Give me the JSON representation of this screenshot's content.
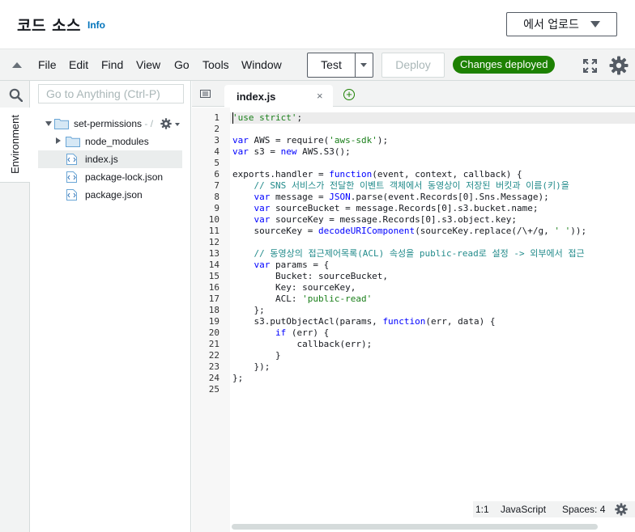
{
  "header": {
    "title": "코드 소스",
    "info_link": "Info",
    "upload_button": "에서 업로드"
  },
  "menubar": {
    "items": [
      "File",
      "Edit",
      "Find",
      "View",
      "Go",
      "Tools",
      "Window"
    ],
    "test_label": "Test",
    "deploy_label": "Deploy",
    "status_badge": "Changes deployed"
  },
  "sidebar": {
    "tab_label": "Environment",
    "search_placeholder": "Go to Anything (Ctrl-P)"
  },
  "tree": {
    "root": "set-permissions",
    "root_suffix": " - /",
    "items": [
      {
        "name": "node_modules",
        "type": "folder"
      },
      {
        "name": "index.js",
        "type": "file",
        "selected": true
      },
      {
        "name": "package-lock.json",
        "type": "file"
      },
      {
        "name": "package.json",
        "type": "file"
      }
    ]
  },
  "editor": {
    "tab_label": "index.js",
    "tab_close": "×",
    "add_tab": "+",
    "active_line": 1,
    "lines": [
      "'use strict';",
      "",
      "var AWS = require('aws-sdk');",
      "var s3 = new AWS.S3();",
      "",
      "exports.handler = function(event, context, callback) {",
      "    // SNS 서비스가 전달한 이벤트 객체에서 동영상이 저장된 버킷과 이름(키)을",
      "    var message = JSON.parse(event.Records[0].Sns.Message);",
      "    var sourceBucket = message.Records[0].s3.bucket.name;",
      "    var sourceKey = message.Records[0].s3.object.key;",
      "    sourceKey = decodeURIComponent(sourceKey.replace(/\\+/g, ' '));",
      "",
      "    // 동영상의 접근제어목록(ACL) 속성을 public-read로 설정 -> 외부에서 접근",
      "    var params = {",
      "        Bucket: sourceBucket,",
      "        Key: sourceKey,",
      "        ACL: 'public-read'",
      "    };",
      "    s3.putObjectAcl(params, function(err, data) {",
      "        if (err) {",
      "            callback(err);",
      "        }",
      "    });",
      "};",
      ""
    ]
  },
  "statusbar": {
    "position": "1:1",
    "language": "JavaScript",
    "spaces": "Spaces: 4"
  },
  "colors": {
    "accent": "#0073bb",
    "success": "#1d8102",
    "border": "#d5dbdb",
    "panel_bg": "#f2f3f3"
  }
}
